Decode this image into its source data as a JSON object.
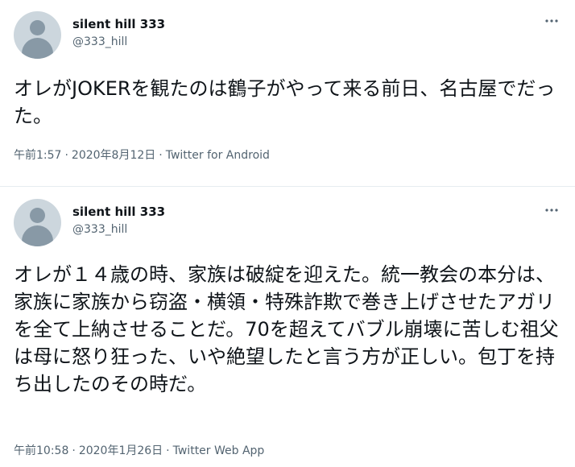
{
  "tweets": [
    {
      "display_name": "silent hill 333",
      "handle": "@333_hill",
      "text": "オレがJOKERを観たのは鶴子がやって来る前日、名古屋でだった。",
      "time": "午前1:57",
      "date": "2020年8月12日",
      "separator": "·",
      "source": "Twitter for Android",
      "avatar_icon": "default-profile-icon",
      "more_icon": "more-horizontal-icon"
    },
    {
      "display_name": "silent hill 333",
      "handle": "@333_hill",
      "text": "オレが１４歳の時、家族は破綻を迎えた。統一教会の本分は、家族に家族から窃盗・横領・特殊詐欺で巻き上げさせたアガリを全て上納させることだ。70を超えてバブル崩壊に苦しむ祖父は母に怒り狂った、いや絶望したと言う方が正しい。包丁を持ち出したのその時だ。",
      "time": "午前10:58",
      "date": "2020年1月26日",
      "separator": "·",
      "source": "Twitter Web App",
      "avatar_icon": "default-profile-icon",
      "more_icon": "more-horizontal-icon"
    }
  ],
  "colors": {
    "text_primary": "#0f1419",
    "text_secondary": "#536471",
    "avatar_bg": "#ccd6dd",
    "avatar_fg": "#8899a6",
    "divider": "#e6ecf0"
  }
}
